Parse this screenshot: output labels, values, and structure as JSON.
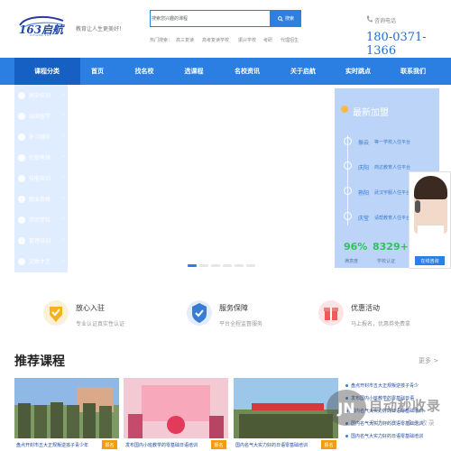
{
  "header": {
    "logo_text": "163启航",
    "logo_sub": "QIHANG 163",
    "slogan": "教育让人生更美好！",
    "search_placeholder": "搜索您兴趣的课程",
    "search_button": "搜索",
    "hot_label": "热门搜索：",
    "hot_items": [
      "高三复读",
      "高考复读学校",
      "振兴学校",
      "考研",
      "代理招生"
    ],
    "phone_label": "咨询电话",
    "phone_number": "180-0371-1366"
  },
  "nav": {
    "items": [
      "课程分类",
      "首页",
      "找名校",
      "选课程",
      "名校资讯",
      "关于启航",
      "实时跳点",
      "联系我们"
    ]
  },
  "sidebar": {
    "items": [
      "高中培训",
      "出国留学",
      "补习辅导",
      "在职考研",
      "技能培训",
      "职业资格",
      "学历学位",
      "管理培训",
      "文体才艺"
    ]
  },
  "panel": {
    "title": "最新加盟",
    "entries": [
      {
        "name": "振云",
        "text": "等一学校入住平台"
      },
      {
        "name": "庆阳",
        "text": "商达教育人住平台"
      },
      {
        "name": "熟阳",
        "text": "武汉宇服人住平台"
      },
      {
        "name": "庆莹",
        "text": "请帮教育人住平台"
      }
    ],
    "stats": [
      {
        "value": "96%",
        "label": "满意度"
      },
      {
        "value": "8329+",
        "label": "学校认证"
      }
    ]
  },
  "consult": {
    "button": "在线咨询"
  },
  "features": [
    {
      "title": "放心入驻",
      "sub": "专业认证真实性认证",
      "color": "#f5b21c"
    },
    {
      "title": "服务保障",
      "sub": "平台全程监督服务",
      "color": "#3a7bd5"
    },
    {
      "title": "优惠活动",
      "sub": "马上报名，优惠券免费拿",
      "color": "#ef5a5a"
    }
  ],
  "courses": {
    "title": "推荐课程",
    "more": "更多 >",
    "cards": [
      {
        "caption": "盘点开封市五大正规叛逆孩子青少年",
        "badge": "报名"
      },
      {
        "caption": "发布国内小班教学的零基础日语培训",
        "badge": "报名"
      },
      {
        "caption": "国内名气大实力好的日语零基础培训",
        "badge": "报名"
      }
    ],
    "news": [
      "盘点开封市五大正规叛逆孩子青少",
      "发布国内小班教学的零基础日语",
      "国内名气大实力好的日语零基础培训",
      "国内名气大实力好的日语零基础培训",
      "国内名气大实力好的日语零基础培训"
    ]
  },
  "watermark": {
    "logo": "JN",
    "title": "自动秒收录",
    "sub": "来访一次 · 永久收录"
  }
}
